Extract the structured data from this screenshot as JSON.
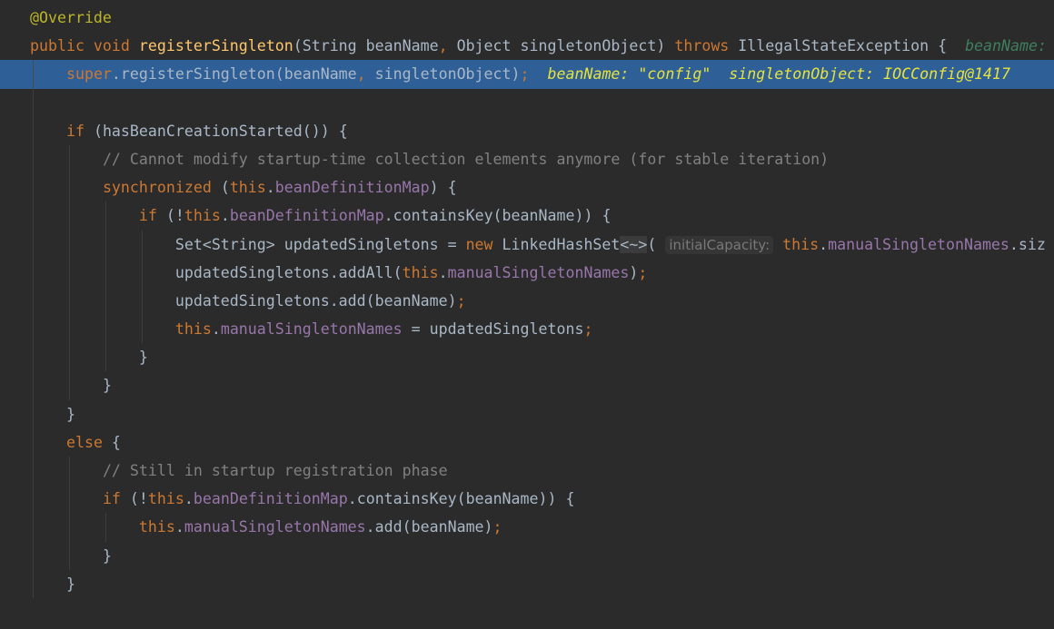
{
  "editor": {
    "current_line": 2,
    "colors": {
      "background": "#2b2b2b",
      "keyword": "#cc7832",
      "annotation": "#bbb529",
      "method_declaration": "#ffc66d",
      "field": "#9876aa",
      "comment": "#808080",
      "text": "#a9b7c6",
      "selection": "#2f5f97",
      "debug_value": "#e6e23c"
    },
    "lines": [
      {
        "indent": 0,
        "tokens": [
          [
            "ann",
            "@Override"
          ]
        ]
      },
      {
        "indent": 0,
        "tokens": [
          [
            "kw",
            "public void "
          ],
          [
            "decl",
            "registerSingleton"
          ],
          [
            "",
            "(String beanName"
          ],
          [
            "punct",
            ", "
          ],
          [
            "",
            "Object singletonObject) "
          ],
          [
            "kw",
            "throws "
          ],
          [
            "",
            "IllegalStateException {  "
          ],
          [
            "dbg2",
            "beanName: "
          ]
        ]
      },
      {
        "indent": 1,
        "tokens": [
          [
            "kw",
            "super"
          ],
          [
            "",
            ".registerSingleton(beanName"
          ],
          [
            "punct",
            ", "
          ],
          [
            "",
            "singletonObject)"
          ],
          [
            "punct",
            ";  "
          ],
          [
            "dbg",
            "beanName: \"config\"  singletonObject: IOCConfig@1417"
          ]
        ]
      },
      {
        "indent": 0,
        "tokens": []
      },
      {
        "indent": 1,
        "tokens": [
          [
            "kw",
            "if "
          ],
          [
            "",
            "(hasBeanCreationStarted()) {"
          ]
        ]
      },
      {
        "indent": 2,
        "tokens": [
          [
            "cmt",
            "// Cannot modify startup-time collection elements anymore (for stable iteration)"
          ]
        ]
      },
      {
        "indent": 2,
        "tokens": [
          [
            "kw",
            "synchronized "
          ],
          [
            "",
            "("
          ],
          [
            "kw",
            "this"
          ],
          [
            "",
            "."
          ],
          [
            "field",
            "beanDefinitionMap"
          ],
          [
            "",
            ") {"
          ]
        ]
      },
      {
        "indent": 3,
        "tokens": [
          [
            "kw",
            "if "
          ],
          [
            "",
            "(!"
          ],
          [
            "kw",
            "this"
          ],
          [
            "",
            "."
          ],
          [
            "field",
            "beanDefinitionMap"
          ],
          [
            "",
            ".containsKey(beanName)) {"
          ]
        ]
      },
      {
        "indent": 4,
        "tokens": [
          [
            "",
            "Set<String> updatedSingletons = "
          ],
          [
            "kw",
            "new "
          ],
          [
            "",
            "LinkedHashSet"
          ],
          [
            "brace",
            "<~>"
          ],
          [
            "",
            "( "
          ],
          [
            "hint",
            "initialCapacity:"
          ],
          [
            "",
            " "
          ],
          [
            "kw",
            "this"
          ],
          [
            "",
            "."
          ],
          [
            "field",
            "manualSingletonNames"
          ],
          [
            "",
            ".siz"
          ]
        ]
      },
      {
        "indent": 4,
        "tokens": [
          [
            "",
            "updatedSingletons.addAll("
          ],
          [
            "kw",
            "this"
          ],
          [
            "",
            "."
          ],
          [
            "field",
            "manualSingletonNames"
          ],
          [
            "",
            ")"
          ],
          [
            "punct",
            ";"
          ]
        ]
      },
      {
        "indent": 4,
        "tokens": [
          [
            "",
            "updatedSingletons.add(beanName)"
          ],
          [
            "punct",
            ";"
          ]
        ]
      },
      {
        "indent": 4,
        "tokens": [
          [
            "kw",
            "this"
          ],
          [
            "",
            "."
          ],
          [
            "field",
            "manualSingletonNames"
          ],
          [
            "",
            " = updatedSingletons"
          ],
          [
            "punct",
            ";"
          ]
        ]
      },
      {
        "indent": 3,
        "tokens": [
          [
            "",
            "}"
          ]
        ]
      },
      {
        "indent": 2,
        "tokens": [
          [
            "",
            "}"
          ]
        ]
      },
      {
        "indent": 1,
        "tokens": [
          [
            "",
            "}"
          ]
        ]
      },
      {
        "indent": 1,
        "tokens": [
          [
            "kw",
            "else "
          ],
          [
            "",
            "{"
          ]
        ]
      },
      {
        "indent": 2,
        "tokens": [
          [
            "cmt",
            "// Still in startup registration phase"
          ]
        ]
      },
      {
        "indent": 2,
        "tokens": [
          [
            "kw",
            "if "
          ],
          [
            "",
            "(!"
          ],
          [
            "kw",
            "this"
          ],
          [
            "",
            "."
          ],
          [
            "field",
            "beanDefinitionMap"
          ],
          [
            "",
            ".containsKey(beanName)) {"
          ]
        ]
      },
      {
        "indent": 3,
        "tokens": [
          [
            "kw",
            "this"
          ],
          [
            "",
            "."
          ],
          [
            "field",
            "manualSingletonNames"
          ],
          [
            "",
            ".add(beanName)"
          ],
          [
            "punct",
            ";"
          ]
        ]
      },
      {
        "indent": 2,
        "tokens": [
          [
            "",
            "}"
          ]
        ]
      },
      {
        "indent": 1,
        "tokens": [
          [
            "",
            "}"
          ]
        ]
      }
    ]
  }
}
